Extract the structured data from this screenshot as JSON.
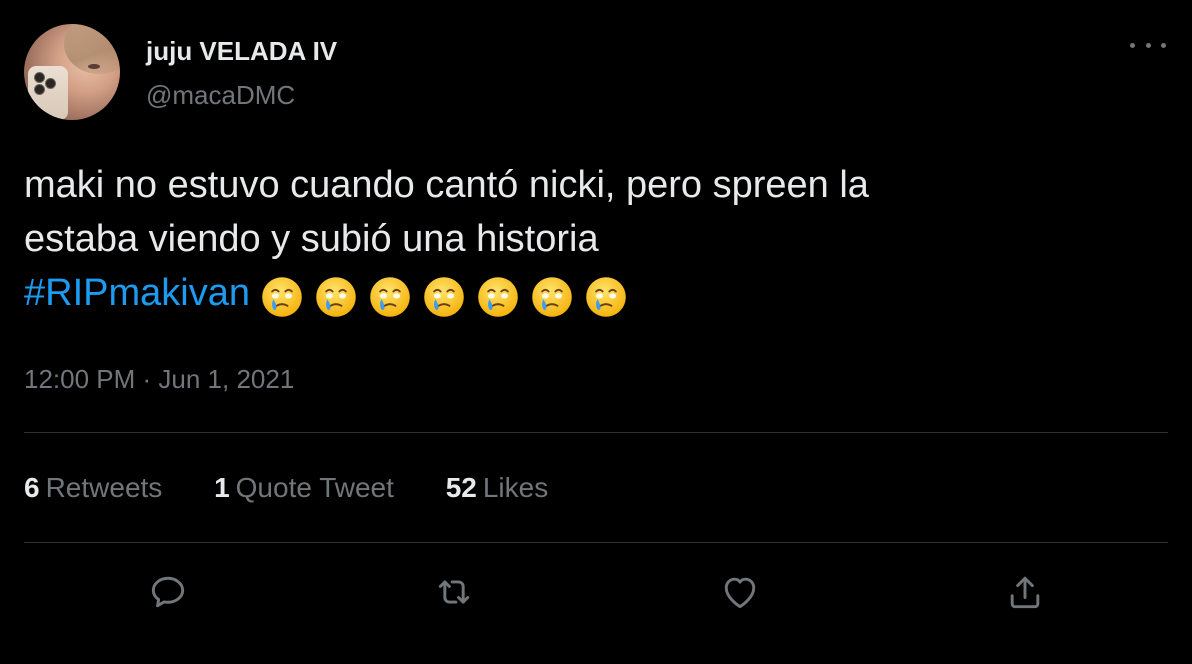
{
  "user": {
    "display_name": "juju VELADA IV",
    "handle": "@macaDMC"
  },
  "tweet": {
    "text": "maki no estuvo cuando cantó nicki, pero spreen la\nestaba viendo y subió una historia\n",
    "hashtag": "#RIPmakivan",
    "emojis": [
      "face-holding-back-tears",
      "face-holding-back-tears",
      "face-holding-back-tears",
      "face-holding-back-tears",
      "face-holding-back-tears",
      "face-holding-back-tears",
      "face-holding-back-tears"
    ],
    "timestamp": "12:00 PM · Jun 1, 2021"
  },
  "stats": {
    "retweets_count": "6",
    "retweets_label": "Retweets",
    "quotes_count": "1",
    "quotes_label": "Quote Tweet",
    "likes_count": "52",
    "likes_label": "Likes"
  },
  "actions": {
    "reply_icon": "reply-icon",
    "retweet_icon": "retweet-icon",
    "like_icon": "heart-icon",
    "share_icon": "share-icon"
  },
  "colors": {
    "background": "#000000",
    "text": "#e7e9ea",
    "secondary": "#71767b",
    "link": "#1d9bf0",
    "divider": "#2f3336"
  }
}
